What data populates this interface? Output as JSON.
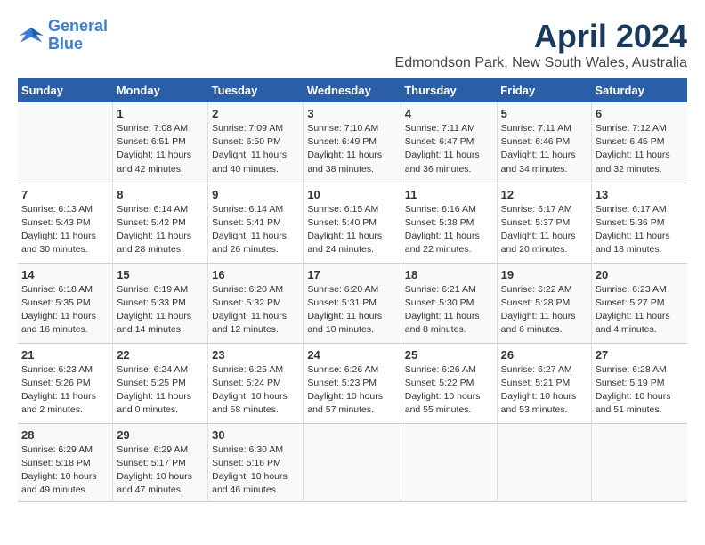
{
  "header": {
    "logo_line1": "General",
    "logo_line2": "Blue",
    "main_title": "April 2024",
    "subtitle": "Edmondson Park, New South Wales, Australia"
  },
  "days_of_week": [
    "Sunday",
    "Monday",
    "Tuesday",
    "Wednesday",
    "Thursday",
    "Friday",
    "Saturday"
  ],
  "weeks": [
    [
      {
        "num": "",
        "info": ""
      },
      {
        "num": "1",
        "info": "Sunrise: 7:08 AM\nSunset: 6:51 PM\nDaylight: 11 hours\nand 42 minutes."
      },
      {
        "num": "2",
        "info": "Sunrise: 7:09 AM\nSunset: 6:50 PM\nDaylight: 11 hours\nand 40 minutes."
      },
      {
        "num": "3",
        "info": "Sunrise: 7:10 AM\nSunset: 6:49 PM\nDaylight: 11 hours\nand 38 minutes."
      },
      {
        "num": "4",
        "info": "Sunrise: 7:11 AM\nSunset: 6:47 PM\nDaylight: 11 hours\nand 36 minutes."
      },
      {
        "num": "5",
        "info": "Sunrise: 7:11 AM\nSunset: 6:46 PM\nDaylight: 11 hours\nand 34 minutes."
      },
      {
        "num": "6",
        "info": "Sunrise: 7:12 AM\nSunset: 6:45 PM\nDaylight: 11 hours\nand 32 minutes."
      }
    ],
    [
      {
        "num": "7",
        "info": "Sunrise: 6:13 AM\nSunset: 5:43 PM\nDaylight: 11 hours\nand 30 minutes."
      },
      {
        "num": "8",
        "info": "Sunrise: 6:14 AM\nSunset: 5:42 PM\nDaylight: 11 hours\nand 28 minutes."
      },
      {
        "num": "9",
        "info": "Sunrise: 6:14 AM\nSunset: 5:41 PM\nDaylight: 11 hours\nand 26 minutes."
      },
      {
        "num": "10",
        "info": "Sunrise: 6:15 AM\nSunset: 5:40 PM\nDaylight: 11 hours\nand 24 minutes."
      },
      {
        "num": "11",
        "info": "Sunrise: 6:16 AM\nSunset: 5:38 PM\nDaylight: 11 hours\nand 22 minutes."
      },
      {
        "num": "12",
        "info": "Sunrise: 6:17 AM\nSunset: 5:37 PM\nDaylight: 11 hours\nand 20 minutes."
      },
      {
        "num": "13",
        "info": "Sunrise: 6:17 AM\nSunset: 5:36 PM\nDaylight: 11 hours\nand 18 minutes."
      }
    ],
    [
      {
        "num": "14",
        "info": "Sunrise: 6:18 AM\nSunset: 5:35 PM\nDaylight: 11 hours\nand 16 minutes."
      },
      {
        "num": "15",
        "info": "Sunrise: 6:19 AM\nSunset: 5:33 PM\nDaylight: 11 hours\nand 14 minutes."
      },
      {
        "num": "16",
        "info": "Sunrise: 6:20 AM\nSunset: 5:32 PM\nDaylight: 11 hours\nand 12 minutes."
      },
      {
        "num": "17",
        "info": "Sunrise: 6:20 AM\nSunset: 5:31 PM\nDaylight: 11 hours\nand 10 minutes."
      },
      {
        "num": "18",
        "info": "Sunrise: 6:21 AM\nSunset: 5:30 PM\nDaylight: 11 hours\nand 8 minutes."
      },
      {
        "num": "19",
        "info": "Sunrise: 6:22 AM\nSunset: 5:28 PM\nDaylight: 11 hours\nand 6 minutes."
      },
      {
        "num": "20",
        "info": "Sunrise: 6:23 AM\nSunset: 5:27 PM\nDaylight: 11 hours\nand 4 minutes."
      }
    ],
    [
      {
        "num": "21",
        "info": "Sunrise: 6:23 AM\nSunset: 5:26 PM\nDaylight: 11 hours\nand 2 minutes."
      },
      {
        "num": "22",
        "info": "Sunrise: 6:24 AM\nSunset: 5:25 PM\nDaylight: 11 hours\nand 0 minutes."
      },
      {
        "num": "23",
        "info": "Sunrise: 6:25 AM\nSunset: 5:24 PM\nDaylight: 10 hours\nand 58 minutes."
      },
      {
        "num": "24",
        "info": "Sunrise: 6:26 AM\nSunset: 5:23 PM\nDaylight: 10 hours\nand 57 minutes."
      },
      {
        "num": "25",
        "info": "Sunrise: 6:26 AM\nSunset: 5:22 PM\nDaylight: 10 hours\nand 55 minutes."
      },
      {
        "num": "26",
        "info": "Sunrise: 6:27 AM\nSunset: 5:21 PM\nDaylight: 10 hours\nand 53 minutes."
      },
      {
        "num": "27",
        "info": "Sunrise: 6:28 AM\nSunset: 5:19 PM\nDaylight: 10 hours\nand 51 minutes."
      }
    ],
    [
      {
        "num": "28",
        "info": "Sunrise: 6:29 AM\nSunset: 5:18 PM\nDaylight: 10 hours\nand 49 minutes."
      },
      {
        "num": "29",
        "info": "Sunrise: 6:29 AM\nSunset: 5:17 PM\nDaylight: 10 hours\nand 47 minutes."
      },
      {
        "num": "30",
        "info": "Sunrise: 6:30 AM\nSunset: 5:16 PM\nDaylight: 10 hours\nand 46 minutes."
      },
      {
        "num": "",
        "info": ""
      },
      {
        "num": "",
        "info": ""
      },
      {
        "num": "",
        "info": ""
      },
      {
        "num": "",
        "info": ""
      }
    ]
  ]
}
